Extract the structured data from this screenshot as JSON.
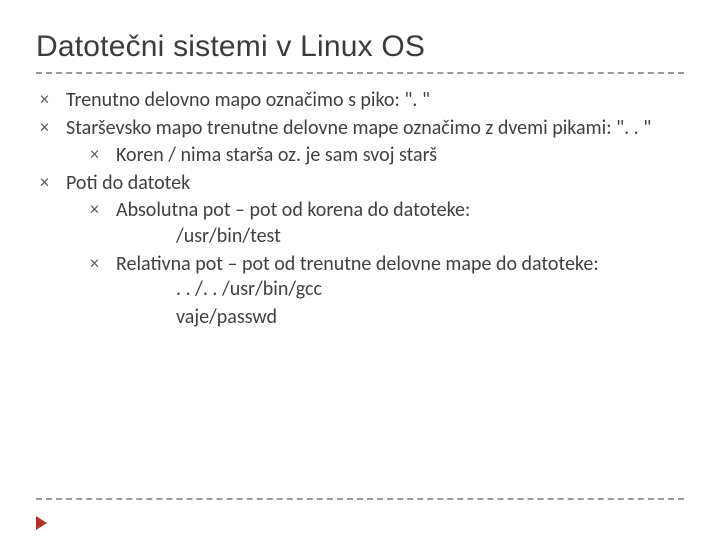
{
  "title": "Datotečni sistemi v Linux OS",
  "bullets": {
    "b1": "Trenutno delovno mapo označimo s piko: \". \"",
    "b2": "Starševsko mapo trenutne delovne mape označimo z dvemi pikami: \". . \"",
    "b2_1": "Koren / nima starša oz. je sam svoj starš",
    "b3": "Poti do datotek",
    "b3_1": "Absolutna pot – pot od korena do datoteke:",
    "b3_1_ex1": "/usr/bin/test",
    "b3_2": "Relativna pot – pot od trenutne delovne mape do datoteke:",
    "b3_2_ex1": ". . /. . /usr/bin/gcc",
    "b3_2_ex2": "vaje/passwd"
  }
}
